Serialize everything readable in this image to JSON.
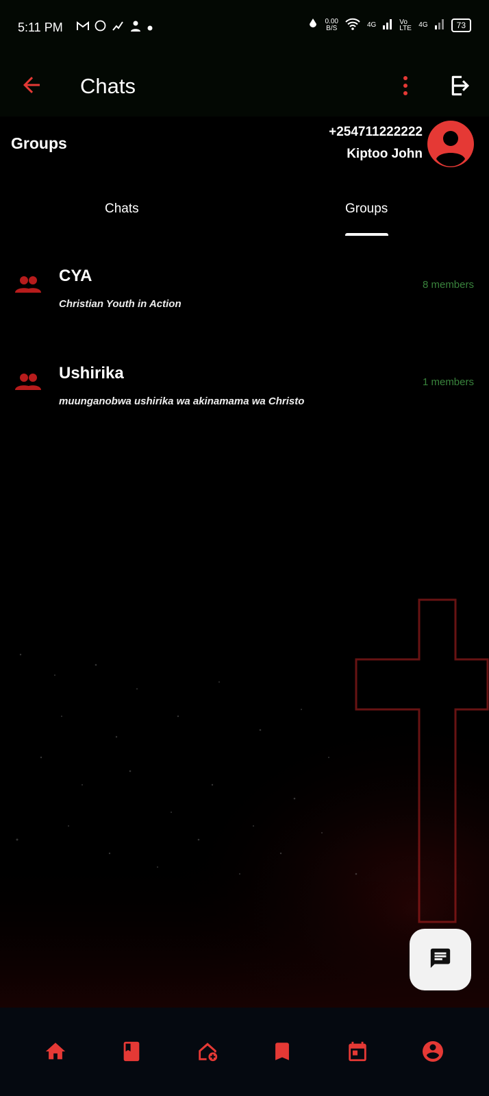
{
  "status_bar": {
    "time": "5:11 PM",
    "data_rate": "0.00",
    "data_unit": "B/S",
    "network1": "4G",
    "network2": "Vo LTE",
    "network3": "4G",
    "battery": "73"
  },
  "app_bar": {
    "title": "Chats",
    "icons": [
      "back-arrow-icon",
      "more-vert-icon",
      "logout-icon"
    ]
  },
  "header": {
    "section_label": "Groups",
    "phone": "+254711222222",
    "user_name": "Kiptoo John"
  },
  "tabs": [
    {
      "label": "Chats",
      "active": false
    },
    {
      "label": "Groups",
      "active": true
    }
  ],
  "groups": [
    {
      "name": "CYA",
      "description": "Christian Youth in Action",
      "members": "8 members"
    },
    {
      "name": "Ushirika",
      "description": "muunganobwa ushirika wa akinamama wa Christo",
      "members": "1 members"
    }
  ],
  "fab": {
    "icon": "chat-icon"
  },
  "bottom_nav": [
    "home-icon",
    "book-icon",
    "add-church-icon",
    "bookmark-icon",
    "calendar-icon",
    "account-icon"
  ],
  "colors": {
    "accent": "#e53935",
    "member_count": "#4caf50",
    "bar": "#030803",
    "nav": "#050910"
  }
}
